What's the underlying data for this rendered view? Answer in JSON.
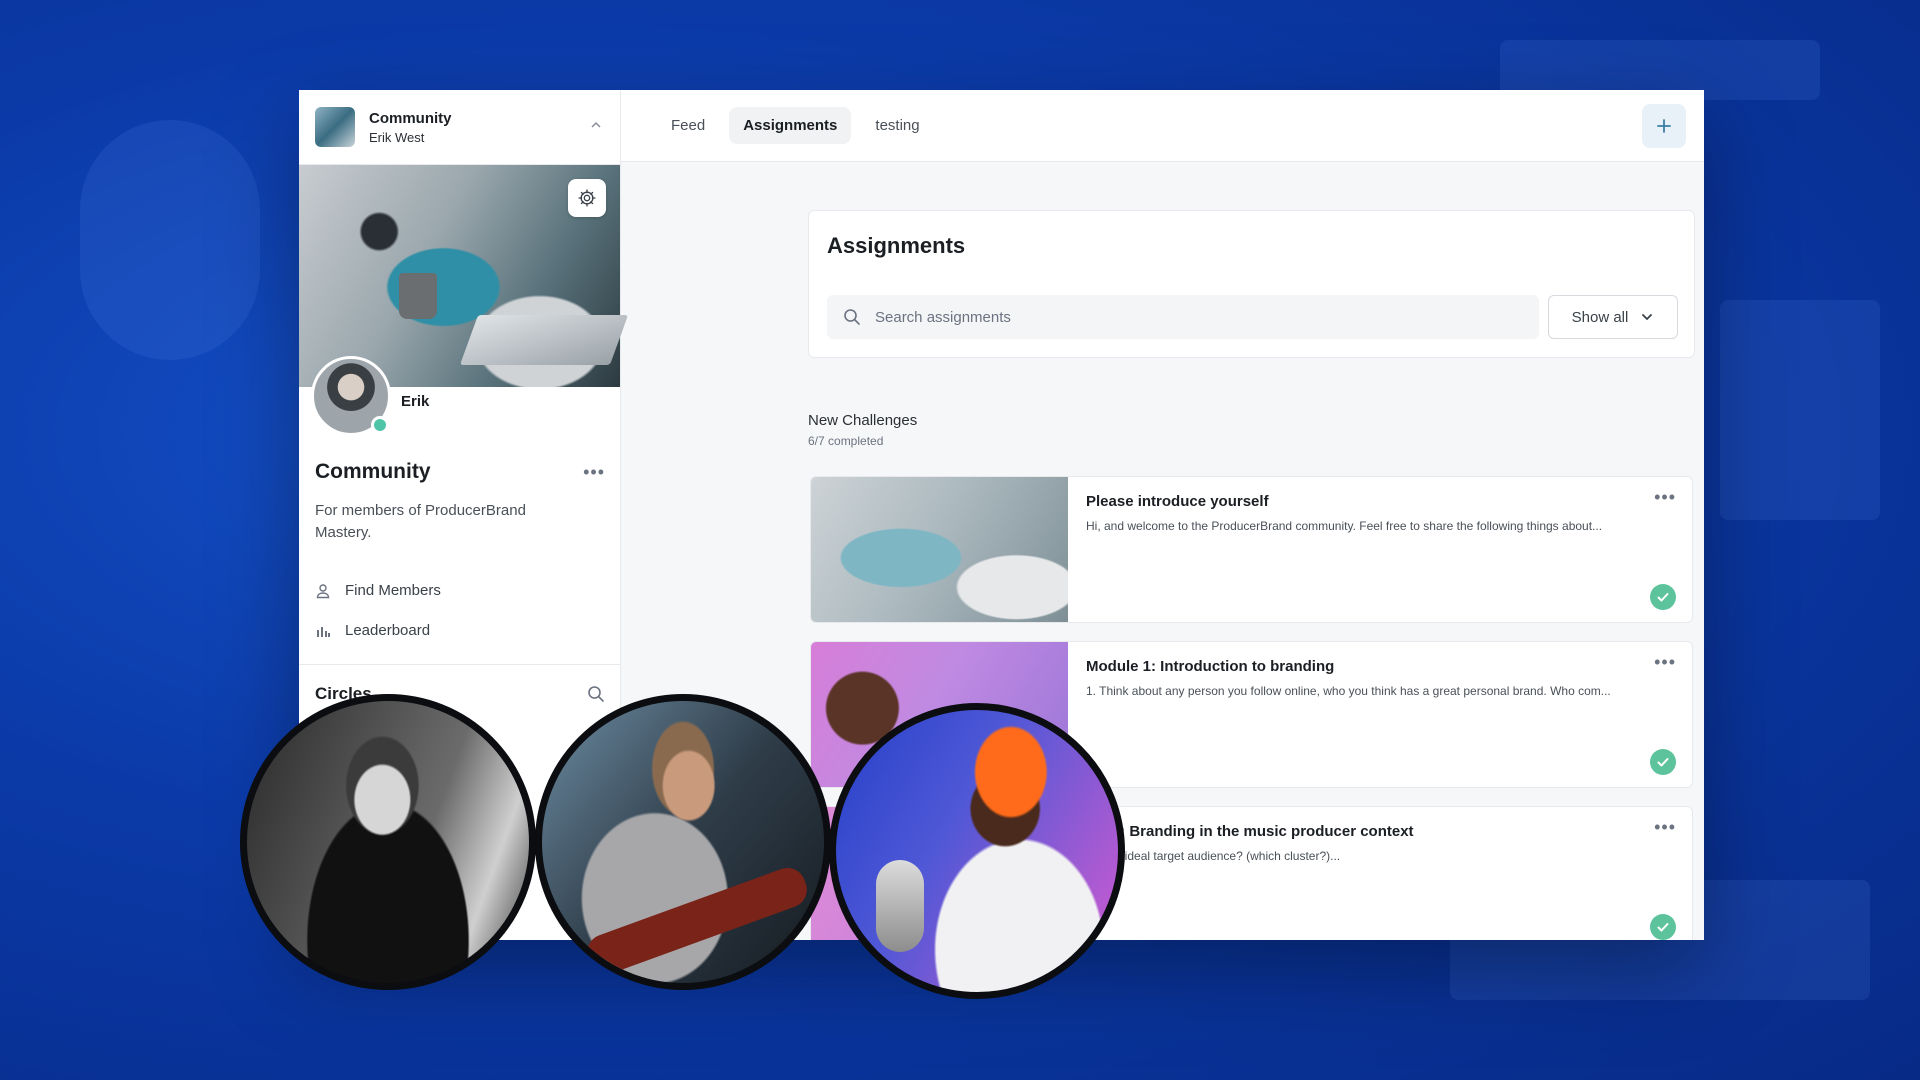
{
  "sidebar": {
    "header": {
      "title": "Community",
      "subtitle": "Erik West"
    },
    "profile_name": "Erik",
    "community": {
      "title": "Community",
      "description": "For members of ProducerBrand Mastery."
    },
    "nav": [
      {
        "label": "Find Members",
        "icon": "person-icon"
      },
      {
        "label": "Leaderboard",
        "icon": "bar-chart-icon"
      }
    ],
    "circles_title": "Circles"
  },
  "tabs": [
    {
      "label": "Feed",
      "active": false
    },
    {
      "label": "Assignments",
      "active": true
    },
    {
      "label": "testing",
      "active": false
    }
  ],
  "assignments": {
    "title": "Assignments",
    "search_placeholder": "Search assignments",
    "filter_label": "Show all",
    "section": {
      "title": "New Challenges",
      "progress": "6/7 completed"
    },
    "items": [
      {
        "title": "Please introduce yourself",
        "description": "Hi, and welcome to the ProducerBrand community. Feel free to share the following things about...",
        "completed": true
      },
      {
        "title": "Module 1: Introduction to branding",
        "description": "1. Think about any person you follow online, who you think has a great personal brand. Who com...",
        "completed": true
      },
      {
        "title": "ule 2: Branding in the music producer context",
        "description": "is your ideal target audience? (which cluster?)...",
        "completed": true
      }
    ]
  },
  "colors": {
    "background": "#0b3aa8",
    "accent": "#4fc4a6",
    "check": "#5cc39d"
  }
}
